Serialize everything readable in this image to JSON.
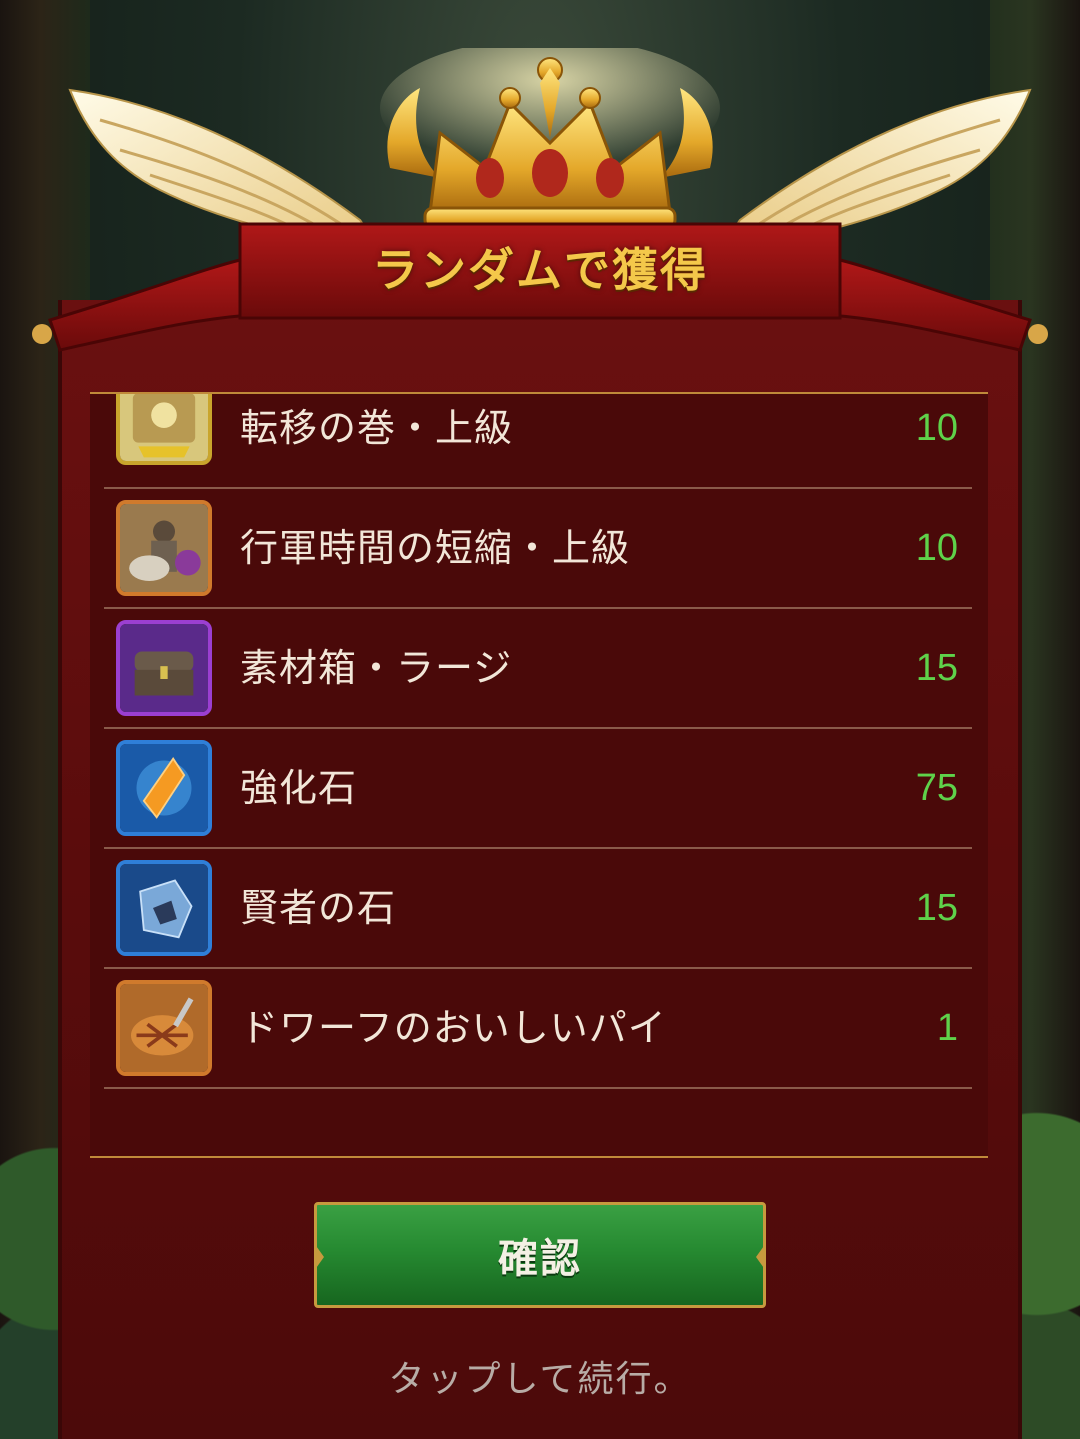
{
  "popup": {
    "title": "ランダムで獲得",
    "confirm_label": "確認",
    "tap_hint": "タップして続行。"
  },
  "rewards": [
    {
      "name": "転移の巻・上級",
      "qty": "10",
      "icon": "teleport-scroll-icon",
      "frame": "#c9a52c"
    },
    {
      "name": "行軍時間の短縮・上級",
      "qty": "10",
      "icon": "knight-cavalry-icon",
      "frame": "#d07a2c"
    },
    {
      "name": "素材箱・ラージ",
      "qty": "15",
      "icon": "treasure-chest-icon",
      "frame": "#9b3fd1"
    },
    {
      "name": "強化石",
      "qty": "75",
      "icon": "orange-crystal-icon",
      "frame": "#2f7fd8"
    },
    {
      "name": "賢者の石",
      "qty": "15",
      "icon": "blue-stone-icon",
      "frame": "#2f7fd8"
    },
    {
      "name": "ドワーフのおいしいパイ",
      "qty": "1",
      "icon": "pie-icon",
      "frame": "#d07a2c"
    }
  ],
  "colors": {
    "title_gold": "#f4c84a",
    "qty_green": "#5fd24a",
    "panel_red": "#5a0c0c",
    "button_green": "#268a31"
  }
}
